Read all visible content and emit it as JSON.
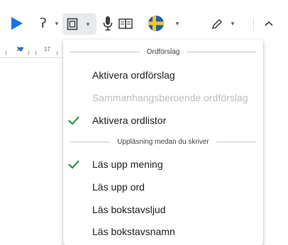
{
  "toolbar": {
    "items": [
      "play",
      "help",
      "page-view",
      "microphone",
      "dictionary",
      "flag",
      "pen",
      "collapse"
    ]
  },
  "ruler": {
    "ticks": [
      "16",
      "17"
    ]
  },
  "menu": {
    "section1_title": "Ordförslag",
    "items1": [
      {
        "label": "Aktivera ordförslag",
        "checked": false,
        "enabled": true
      },
      {
        "label": "Sammanhangsberoende ordförslag",
        "checked": false,
        "enabled": false
      },
      {
        "label": "Aktivera ordlistor",
        "checked": true,
        "enabled": true
      }
    ],
    "section2_title": "Uppläsning medan du skriver",
    "items2": [
      {
        "label": "Läs upp mening",
        "checked": true,
        "enabled": true
      },
      {
        "label": "Läs upp ord",
        "checked": false,
        "enabled": true
      },
      {
        "label": "Läs bokstavsljud",
        "checked": false,
        "enabled": true
      },
      {
        "label": "Läs bokstavsnamn",
        "checked": false,
        "enabled": true
      }
    ]
  },
  "colors": {
    "accent": "#1a73e8",
    "check": "#1e8e3e",
    "disabled": "#b9bcbf"
  }
}
